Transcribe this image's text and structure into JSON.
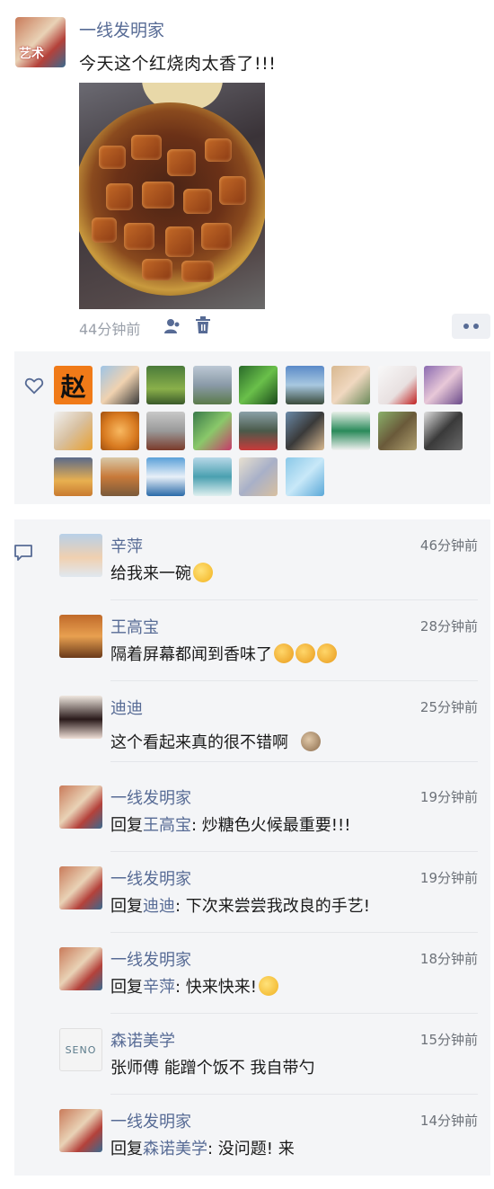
{
  "post": {
    "author": "一线发明家",
    "avatar_text": "艺术",
    "text": "今天这个红烧肉太香了!!!",
    "photo_desc": "红烧肉",
    "time": "44分钟前"
  },
  "likes": {
    "first_liker_text": "赵",
    "count": 24
  },
  "comments": [
    {
      "name": "辛萍",
      "time": "46分钟前",
      "text": "给我来一碗",
      "emoji": "smile-emoji"
    },
    {
      "name": "王高宝",
      "time": "28分钟前",
      "text": "隔着屏幕都闻到香味了",
      "emoji": "drool-emoji-x3"
    },
    {
      "name": "迪迪",
      "time": "25分钟前",
      "text": "这个看起来真的很不错啊",
      "emoji": "hamster-emoji"
    },
    {
      "name": "一线发明家",
      "time": "19分钟前",
      "reply_prefix": "回复",
      "reply_to": "王高宝",
      "text": ": 炒糖色火候最重要!!!"
    },
    {
      "name": "一线发明家",
      "time": "19分钟前",
      "reply_prefix": "回复",
      "reply_to": "迪迪",
      "text": ": 下次来尝尝我改良的手艺!"
    },
    {
      "name": "一线发明家",
      "time": "18分钟前",
      "reply_prefix": "回复",
      "reply_to": "辛萍",
      "text": ": 快来快来!",
      "emoji": "grin-emoji"
    },
    {
      "name": "森诺美学",
      "time": "15分钟前",
      "text": "张师傅 能蹭个饭不 我自带勺"
    },
    {
      "name": "一线发明家",
      "time": "14分钟前",
      "reply_prefix": "回复",
      "reply_to": "森诺美学",
      "text": ": 没问题! 来"
    }
  ],
  "senno_logo_text": "SENO",
  "colors": {
    "link": "#576b95",
    "panel": "#f4f5f7",
    "meta": "#9aa0aa"
  }
}
